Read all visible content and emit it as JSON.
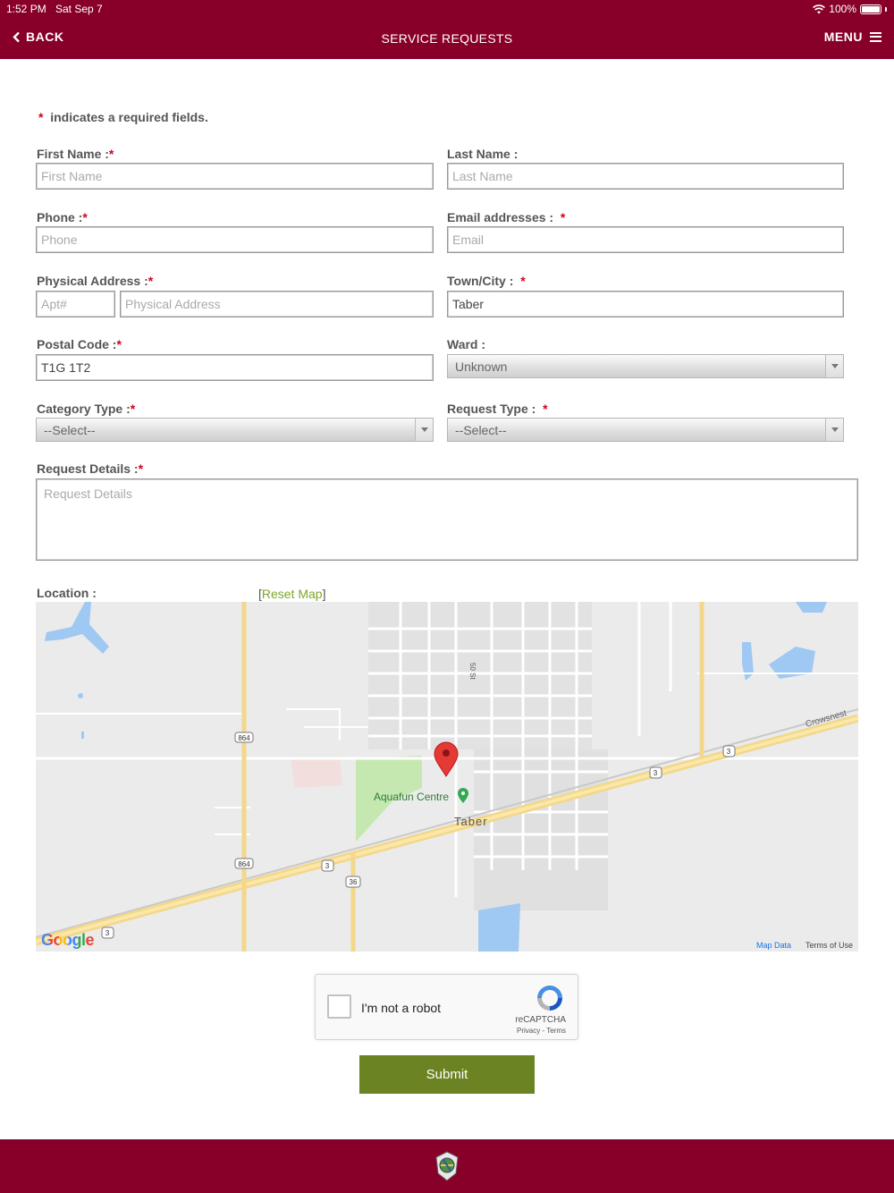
{
  "status_bar": {
    "time": "1:52 PM",
    "date": "Sat Sep 7",
    "battery": "100%"
  },
  "header": {
    "back_label": "BACK",
    "title": "SERVICE REQUESTS",
    "menu_label": "MENU"
  },
  "form": {
    "required_mark": "*",
    "required_notice": "indicates a required fields.",
    "first_name": {
      "label": "First Name :",
      "placeholder": "First Name",
      "value": ""
    },
    "last_name": {
      "label": "Last Name :",
      "placeholder": "Last Name",
      "value": ""
    },
    "phone": {
      "label": "Phone :",
      "placeholder": "Phone",
      "value": ""
    },
    "email": {
      "label": "Email addresses :",
      "placeholder": "Email",
      "value": ""
    },
    "physical_address": {
      "label": "Physical Address :",
      "apt_placeholder": "Apt#",
      "address_placeholder": "Physical Address"
    },
    "town": {
      "label": "Town/City :",
      "value": "Taber"
    },
    "postal_code": {
      "label": "Postal Code :",
      "value": "T1G 1T2"
    },
    "ward": {
      "label": "Ward :",
      "selected": "Unknown"
    },
    "category_type": {
      "label": "Category Type :",
      "selected": "--Select--"
    },
    "request_type": {
      "label": "Request Type :",
      "selected": "--Select--"
    },
    "request_details": {
      "label": "Request Details :",
      "placeholder": "Request Details"
    },
    "location": {
      "label": "Location :",
      "reset_open": "[",
      "reset_label": "Reset Map",
      "reset_close": "]"
    }
  },
  "map": {
    "labels": {
      "aquafun": "Aquafun Centre",
      "town": "Taber",
      "street_50": "50 St",
      "crowsnest": "Crowsnest",
      "hwy_864a": "864",
      "hwy_864b": "864",
      "hwy_3a": "3",
      "hwy_3b": "3",
      "hwy_3c": "3",
      "hwy_3d": "3",
      "hwy_36": "36"
    },
    "google": "Google",
    "map_data": "Map Data",
    "terms": "Terms of Use"
  },
  "recaptcha": {
    "label": "I'm not a robot",
    "brand": "reCAPTCHA",
    "links": "Privacy - Terms"
  },
  "submit_label": "Submit",
  "colors": {
    "brand": "#880029",
    "submit": "#6b8322",
    "link": "#7fa62a",
    "required": "#d0021b"
  }
}
